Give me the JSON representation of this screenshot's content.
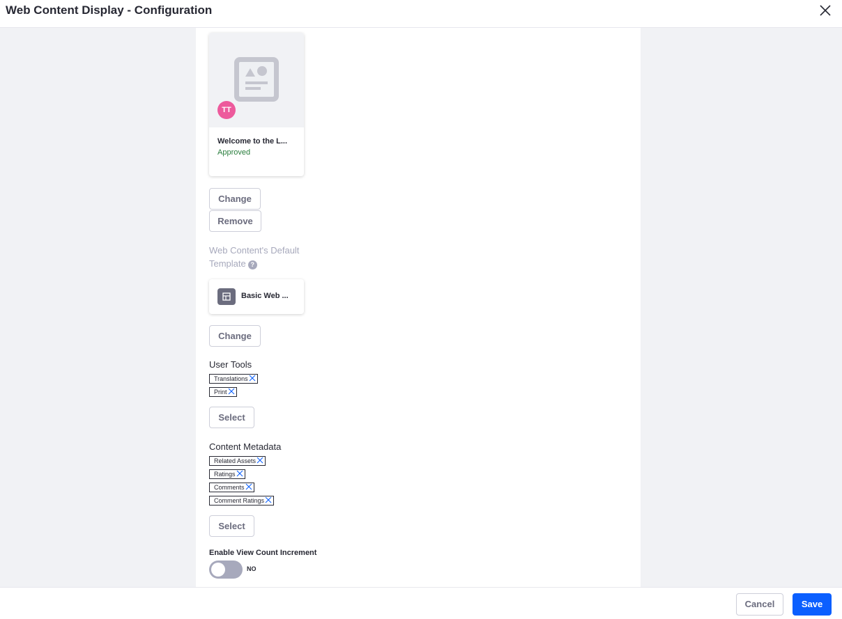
{
  "header": {
    "title": "Web Content Display - Configuration",
    "close_icon": "close-icon"
  },
  "article_card": {
    "avatar_initials": "TT",
    "avatar_color": "#ed5a9c",
    "title": "Welcome to the L...",
    "status": "Approved",
    "status_color": "#287d3c",
    "image_icon": "image-placeholder-icon"
  },
  "article_actions": {
    "change_label": "Change",
    "remove_label": "Remove"
  },
  "template": {
    "label_line1": "Web Content's Default",
    "label_line2": "Template",
    "help_glyph": "?",
    "card_name": "Basic Web ...",
    "card_icon": "template-icon",
    "change_label": "Change"
  },
  "user_tools": {
    "label": "User Tools",
    "tags": [
      "Translations",
      "Print"
    ],
    "select_label": "Select"
  },
  "content_metadata": {
    "label": "Content Metadata",
    "tags": [
      "Related Assets",
      "Ratings",
      "Comments",
      "Comment Ratings"
    ],
    "select_label": "Select"
  },
  "view_count": {
    "label": "Enable View Count Increment",
    "state_text": "NO",
    "enabled": false
  },
  "footer": {
    "cancel_label": "Cancel",
    "save_label": "Save",
    "save_color": "#0b5fff"
  }
}
